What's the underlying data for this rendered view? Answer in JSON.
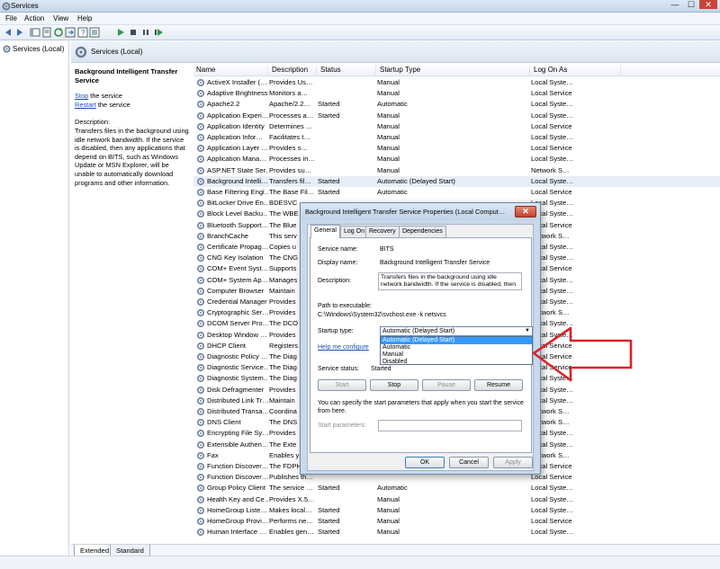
{
  "window": {
    "title": "Services",
    "min": "—",
    "max": "☐",
    "close": "✕"
  },
  "menu": [
    "File",
    "Action",
    "View",
    "Help"
  ],
  "left_pane": {
    "item": "Services (Local)"
  },
  "right_header": {
    "title": "Services (Local)"
  },
  "description": {
    "service_title": "Background Intelligent Transfer Service",
    "stop_link": "Stop",
    "stop_rest": " the service",
    "restart_link": "Restart",
    "restart_rest": " the service",
    "desc_label": "Description:",
    "desc_text": "Transfers files in the background using idle network bandwidth. If the service is disabled, then any applications that depend on BITS, such as Windows Update or MSN Explorer, will be unable to automatically download programs and other information."
  },
  "columns": [
    "Name",
    "Description",
    "Status",
    "Startup Type",
    "Log On As"
  ],
  "services": [
    [
      "ActiveX Installer (…",
      "Provides Us…",
      "",
      "Manual",
      "Local Syste…"
    ],
    [
      "Adaptive Brightness",
      "Monitors a…",
      "",
      "Manual",
      "Local Service"
    ],
    [
      "Apache2.2",
      "Apache/2.2…",
      "Started",
      "Automatic",
      "Local Syste…"
    ],
    [
      "Application Experi…",
      "Processes a…",
      "Started",
      "Manual",
      "Local Syste…"
    ],
    [
      "Application Identity",
      "Determines …",
      "",
      "Manual",
      "Local Service"
    ],
    [
      "Application Infor…",
      "Facilitates t…",
      "",
      "Manual",
      "Local Syste…"
    ],
    [
      "Application Layer …",
      "Provides s…",
      "",
      "Manual",
      "Local Service"
    ],
    [
      "Application Mana…",
      "Processes in…",
      "",
      "Manual",
      "Local Syste…"
    ],
    [
      "ASP.NET State Ser…",
      "Provides su…",
      "",
      "Manual",
      "Network S…"
    ],
    [
      "Background Intelli…",
      "Transfers fil…",
      "Started",
      "Automatic (Delayed Start)",
      "Local Syste…"
    ],
    [
      "Base Filtering Engi…",
      "The Base Fil…",
      "Started",
      "Automatic",
      "Local Service"
    ],
    [
      "BitLocker Drive En…",
      "BDESVC",
      "",
      "",
      "Local Syste…"
    ],
    [
      "Block Level Backu…",
      "The WBE",
      "",
      "",
      "Local Syste…"
    ],
    [
      "Bluetooth Support…",
      "The Blue",
      "",
      "",
      "Local Service"
    ],
    [
      "BranchCache",
      "This serv",
      "",
      "",
      "Network S…"
    ],
    [
      "Certificate Propag…",
      "Copies u",
      "",
      "",
      "Local Syste…"
    ],
    [
      "CNG Key Isolation",
      "The CNG",
      "",
      "",
      "Local Syste…"
    ],
    [
      "COM+ Event Syst…",
      "Supports",
      "",
      "",
      "Local Service"
    ],
    [
      "COM+ System Ap…",
      "Manages",
      "",
      "",
      "Local Syste…"
    ],
    [
      "Computer Browser",
      "Maintain",
      "",
      "",
      "Local Syste…"
    ],
    [
      "Credential Manager",
      "Provides",
      "",
      "",
      "Local Syste…"
    ],
    [
      "Cryptographic Ser…",
      "Provides",
      "",
      "",
      "Network S…"
    ],
    [
      "DCOM Server Pro…",
      "The DCO",
      "",
      "",
      "Local Syste…"
    ],
    [
      "Desktop Window …",
      "Provides",
      "",
      "",
      "Local Syste…"
    ],
    [
      "DHCP Client",
      "Registers",
      "",
      "",
      "Local Service"
    ],
    [
      "Diagnostic Policy …",
      "The Diag",
      "",
      "",
      "Local Service"
    ],
    [
      "Diagnostic Service…",
      "The Diag",
      "",
      "",
      "Local Service"
    ],
    [
      "Diagnostic System…",
      "The Diag",
      "",
      "",
      "Local Syste…"
    ],
    [
      "Disk Defragmenter",
      "Provides",
      "",
      "",
      "Local Syste…"
    ],
    [
      "Distributed Link Tr…",
      "Maintain",
      "",
      "",
      "Local Syste…"
    ],
    [
      "Distributed Transa…",
      "Coordina",
      "",
      "",
      "Network S…"
    ],
    [
      "DNS Client",
      "The DNS",
      "",
      "",
      "Network S…"
    ],
    [
      "Encrypting File Sy…",
      "Provides",
      "",
      "",
      "Local Syste…"
    ],
    [
      "Extensible Authen…",
      "The Exte",
      "",
      "",
      "Local Syste…"
    ],
    [
      "Fax",
      "Enables y",
      "",
      "",
      "Network S…"
    ],
    [
      "Function Discover…",
      "The FDPH",
      "",
      "",
      "Local Service"
    ],
    [
      "Function Discover…",
      "Publishes th…",
      "",
      "",
      "Local Service"
    ],
    [
      "Group Policy Client",
      "The service …",
      "Started",
      "Automatic",
      "Local Syste…"
    ],
    [
      "Health Key and Ce…",
      "Provides X.5…",
      "",
      "Manual",
      "Local Syste…"
    ],
    [
      "HomeGroup Liste…",
      "Makes local…",
      "Started",
      "Manual",
      "Local Syste…"
    ],
    [
      "HomeGroup Provi…",
      "Performs ne…",
      "Started",
      "Manual",
      "Local Service"
    ],
    [
      "Human Interface …",
      "Enables gen…",
      "Started",
      "Manual",
      "Local Syste…"
    ]
  ],
  "bottom_tabs": [
    "Extended",
    "Standard"
  ],
  "dialog": {
    "title": "Background Intelligent Transfer Service Properties (Local Comput…",
    "close": "✕",
    "tabs": [
      "General",
      "Log On",
      "Recovery",
      "Dependencies"
    ],
    "service_name_label": "Service name:",
    "service_name": "BITS",
    "display_name_label": "Display name:",
    "display_name": "Background Intelligent Transfer Service",
    "description_label": "Description:",
    "description": "Transfers files in the background using idle network bandwidth. If the service is disabled, then any",
    "path_label": "Path to executable:",
    "path": "C:\\Windows\\System32\\svchost.exe -k netsvcs",
    "startup_label": "Startup type:",
    "startup_value": "Automatic (Delayed Start)",
    "startup_options": [
      "Automatic (Delayed Start)",
      "Automatic",
      "Manual",
      "Disabled"
    ],
    "help_link": "Help me configure",
    "status_label": "Service status:",
    "status_value": "Started",
    "btn_start": "Start",
    "btn_stop": "Stop",
    "btn_pause": "Pause",
    "btn_resume": "Resume",
    "params_note": "You can specify the start parameters that apply when you start the service from here.",
    "params_label": "Start parameters:",
    "ok": "OK",
    "cancel": "Cancel",
    "apply": "Apply"
  },
  "colors": {
    "arrow": "#d9232a",
    "link": "#1a4fb5",
    "highlight": "#3399ff"
  }
}
